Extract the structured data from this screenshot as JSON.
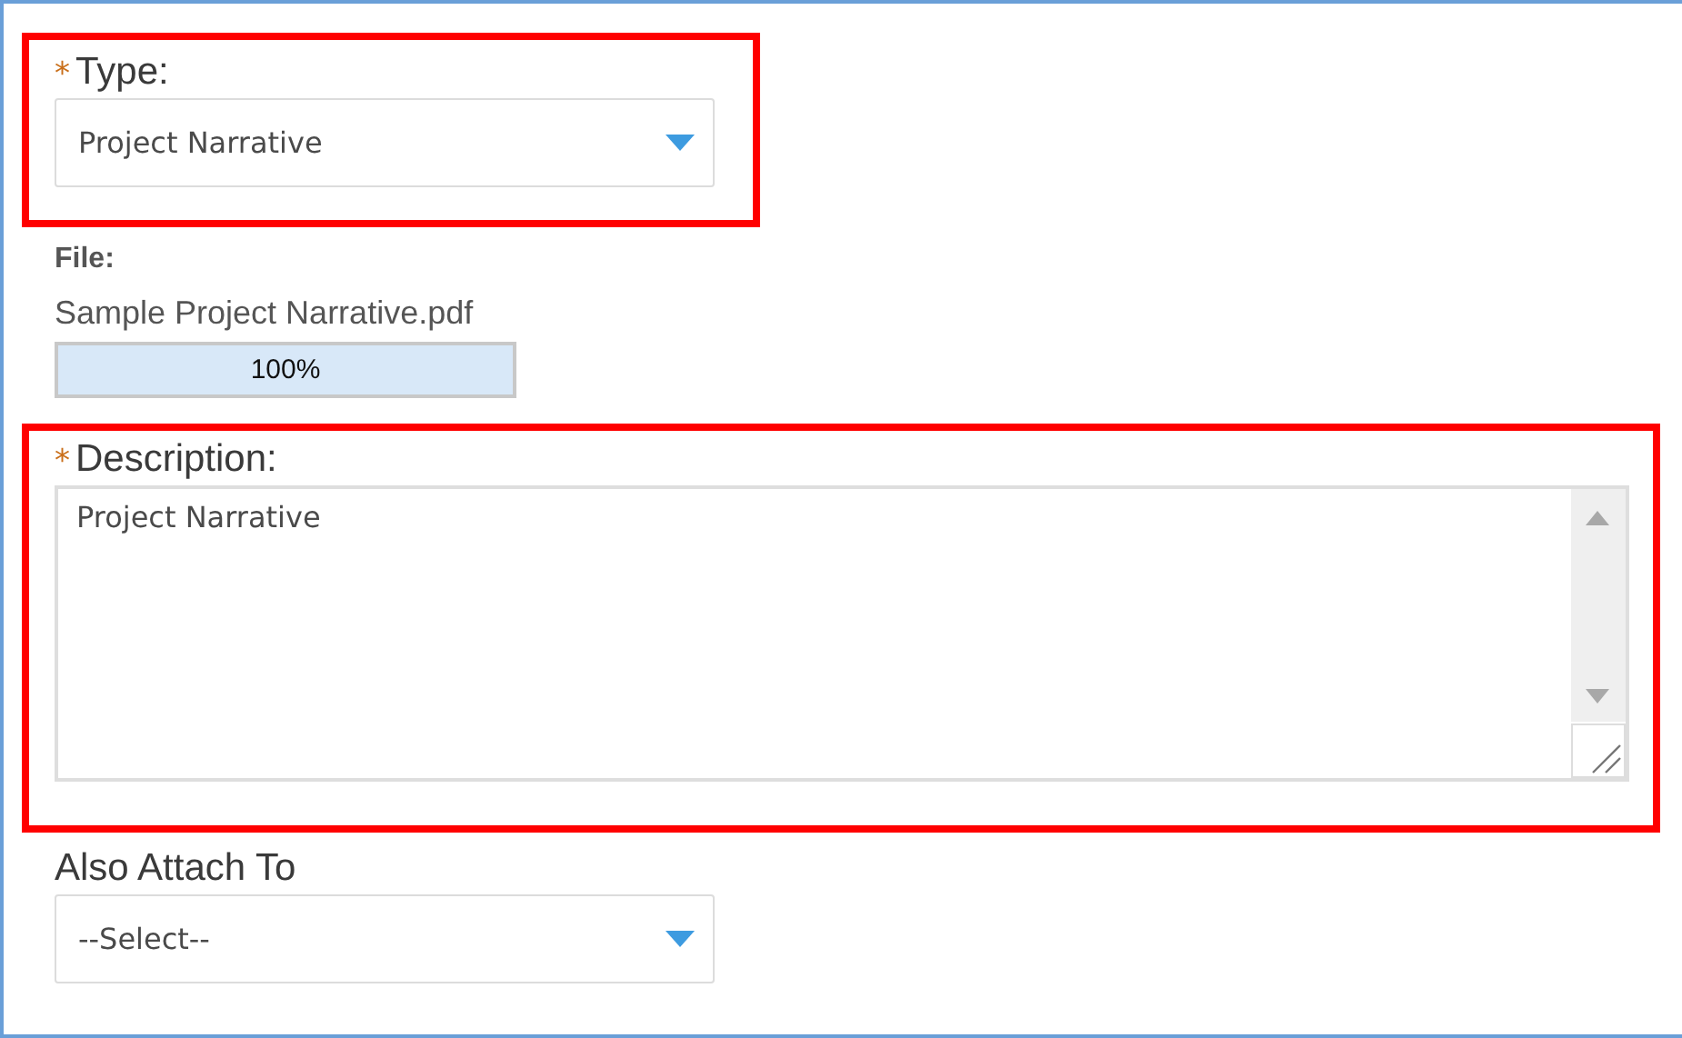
{
  "fields": [
    {
      "kind": "select",
      "mark": "*",
      "label": "Type:",
      "value": "Project Narrative",
      "highlighted": true
    },
    {
      "kind": "file",
      "label": "File:",
      "file_name": "Sample Project Narrative.pdf",
      "level": 1,
      "reading": "100%",
      "highlighted": false
    },
    {
      "kind": "textarea",
      "mark": "*",
      "label": "Description:",
      "value": "Project Narrative",
      "highlighted": true
    },
    {
      "kind": "select",
      "label": "Also Attach To",
      "value": "--Select--",
      "highlighted": false
    }
  ]
}
